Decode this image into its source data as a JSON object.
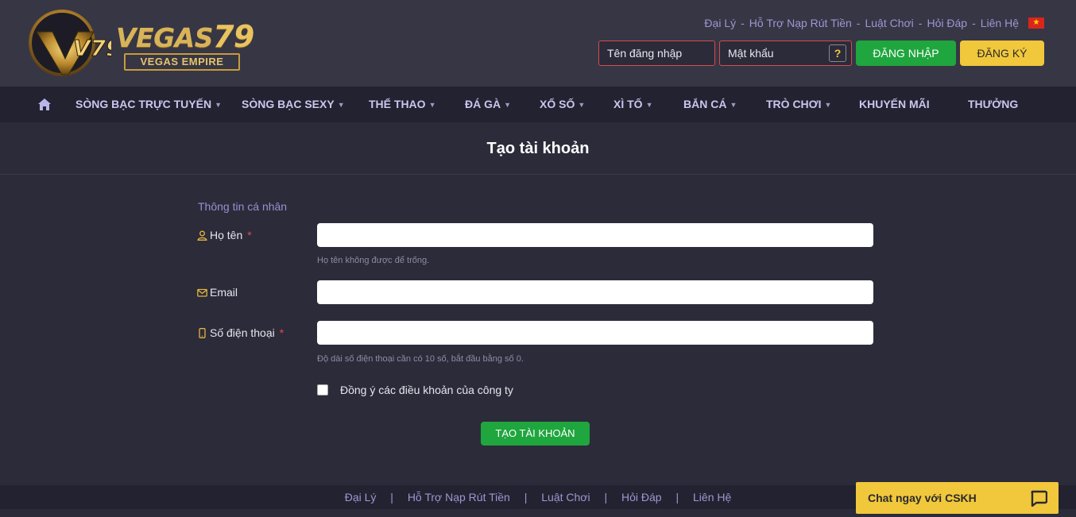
{
  "brand": {
    "word": "VEGAS",
    "number": "79",
    "emblem_text": "V79",
    "tagline": "VEGAS EMPIRE",
    "gold": "#d8b35a"
  },
  "toplinks": [
    "Đại Lý",
    "Hỗ Trợ Nạp Rút Tiền",
    "Luật Chơi",
    "Hỏi Đáp",
    "Liên Hệ"
  ],
  "toplink_separator": "-",
  "language_flag": "vietnam-flag-icon",
  "login": {
    "username_placeholder": "Tên đăng nhập",
    "password_placeholder": "Mật khẩu",
    "help_symbol": "?",
    "login_label": "ĐĂNG NHẬP",
    "register_label": "ĐĂNG KÝ"
  },
  "nav": {
    "home_icon": "home-icon",
    "items": [
      {
        "label": "SÒNG BẠC TRỰC TUYẾN",
        "dropdown": true
      },
      {
        "label": "SÒNG BẠC SEXY",
        "dropdown": true
      },
      {
        "label": "THỂ THAO",
        "dropdown": true
      },
      {
        "label": "ĐÁ GÀ",
        "dropdown": true
      },
      {
        "label": "XỔ SỐ",
        "dropdown": true
      },
      {
        "label": "XÌ TỐ",
        "dropdown": true
      },
      {
        "label": "BẮN CÁ",
        "dropdown": true
      },
      {
        "label": "TRÒ CHƠI",
        "dropdown": true
      },
      {
        "label": "KHUYẾN MÃI",
        "dropdown": false
      },
      {
        "label": "THƯỞNG",
        "dropdown": false
      }
    ]
  },
  "page": {
    "title": "Tạo tài khoản",
    "section": "Thông tin cá nhân",
    "fields": {
      "fullname": {
        "label": "Họ tên",
        "required": "*",
        "value": "",
        "hint": "Họ tên không được để trống."
      },
      "email": {
        "label": "Email",
        "value": ""
      },
      "phone": {
        "label": "Số điện thoại",
        "required": "*",
        "value": "",
        "hint": "Độ dài số điện thoại cần có 10 số, bắt đầu bằng số 0."
      }
    },
    "agree_label": "Đồng ý các điều khoản của công ty",
    "agree_checked": false,
    "submit_label": "TẠO TÀI KHOẢN"
  },
  "footer": {
    "links": [
      "Đại Lý",
      "Hỗ Trợ Nạp Rút Tiền",
      "Luật Chơi",
      "Hỏi Đáp",
      "Liên Hệ"
    ],
    "separator": "|"
  },
  "chat": {
    "label": "Chat ngay với CSKH",
    "icon": "chat-bubble-icon"
  },
  "colors": {
    "background": "#2c2b3a",
    "header": "#373645",
    "nav": "#232230",
    "green": "#1fa63e",
    "yellow": "#f1c73c",
    "link": "#9b98d2",
    "required": "#e84848"
  }
}
